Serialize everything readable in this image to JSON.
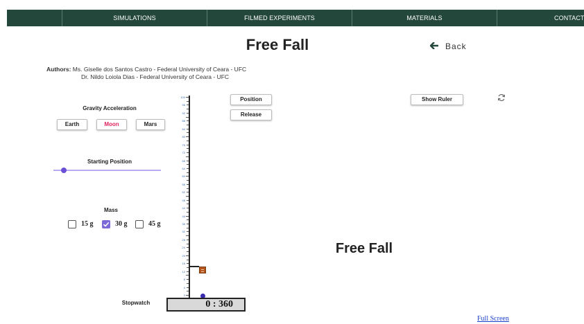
{
  "nav": {
    "items": [
      "SIMULATIONS",
      "FILMED EXPERIMENTS",
      "MATERIALS",
      "CONTACT"
    ]
  },
  "page": {
    "title": "Free Fall",
    "back_label": "Back",
    "authors_label": "Authors:",
    "authors_line1": "Ms. Giselle dos Santos Castro - Federal University of Ceara - UFC",
    "authors_line2": "Dr. Nildo Loiola Dias - Federal University of Ceara - UFC"
  },
  "sim": {
    "gravity_label": "Gravity Acceleration",
    "gravity_options": [
      "Earth",
      "Moon",
      "Mars"
    ],
    "gravity_selected": "Moon",
    "starting_position_label": "Starting Position",
    "mass_label": "Mass",
    "mass_options": [
      "15 g",
      "30 g",
      "45 g"
    ],
    "mass_selected": "30 g",
    "position_button": "Position",
    "release_button": "Release",
    "show_ruler_button": "Show Ruler",
    "stopwatch_label": "Stopwatch",
    "stopwatch_value": "0 : 360",
    "canvas_title": "Free Fall",
    "ruler_max": 100,
    "ruler_step": 2,
    "slider_value_fraction": 0.1,
    "colors": {
      "accent": "#7b6ad8",
      "selected_text": "#e0245e",
      "nav_bg": "#24473c",
      "object": "#b5561f"
    }
  },
  "footer": {
    "full_screen_link": "Full Screen"
  }
}
